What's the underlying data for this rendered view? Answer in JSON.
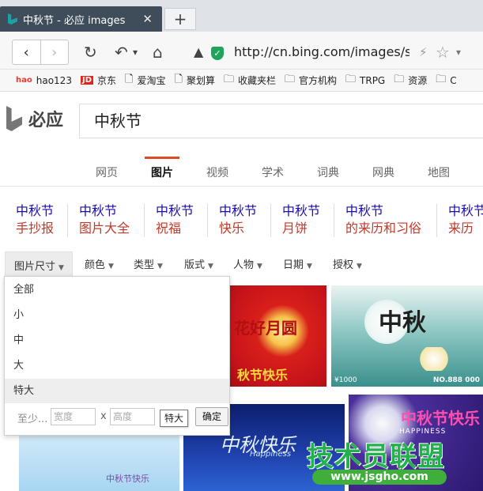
{
  "browser": {
    "tab_title": "中秋节 - 必应 images",
    "tab_close": "✕",
    "new_tab": "+",
    "url": "http://cn.bing.com/images/searc",
    "back": "‹",
    "forward": "›",
    "reload": "↻",
    "undo": "↶",
    "undo_caret": "▾",
    "home": "⌂",
    "bolt": "⚡",
    "star": "☆",
    "menu_caret": "▾",
    "bookmarks": [
      {
        "label": "hao123",
        "icon": "hao123-icon"
      },
      {
        "label": "京东",
        "icon": "jd-icon"
      },
      {
        "label": "爱淘宝",
        "icon": "page-icon"
      },
      {
        "label": "聚划算",
        "icon": "page-icon"
      },
      {
        "label": "收藏夹栏",
        "icon": "folder-icon"
      },
      {
        "label": "官方机构",
        "icon": "folder-icon"
      },
      {
        "label": "TRPG",
        "icon": "folder-icon"
      },
      {
        "label": "资源",
        "icon": "folder-icon"
      },
      {
        "label": "C",
        "icon": "folder-icon"
      }
    ]
  },
  "bing": {
    "logo_text": "必应",
    "query": "中秋节",
    "scopes": [
      "网页",
      "图片",
      "视频",
      "学术",
      "词典",
      "网典",
      "地图"
    ],
    "active_scope": "图片",
    "accent_color": "#de4a26",
    "related": [
      {
        "l1": "中秋节",
        "l2": "手抄报"
      },
      {
        "l1": "中秋节",
        "l2": "图片大全"
      },
      {
        "l1": "中秋节",
        "l2": "祝福"
      },
      {
        "l1": "中秋节",
        "l2": "快乐"
      },
      {
        "l1": "中秋节",
        "l2": "月饼"
      },
      {
        "l1": "中秋节",
        "l2": "的来历和习俗"
      },
      {
        "l1": "中秋节",
        "l2": "来历"
      }
    ],
    "filters": [
      "图片尺寸",
      "颜色",
      "类型",
      "版式",
      "人物",
      "日期",
      "授权"
    ],
    "size_dropdown": {
      "options": [
        "全部",
        "小",
        "中",
        "大",
        "特大"
      ],
      "highlighted": "特大",
      "custom_label": "至少...",
      "width_placeholder": "宽度",
      "height_placeholder": "高度",
      "times": "x",
      "ok": "确定",
      "tooltip": "特大"
    },
    "images": [
      {
        "t1": "花好月圆",
        "t2": "秋节快乐"
      },
      {
        "t1": "中秋",
        "t2": "NO.888 000",
        "t3": "¥1000"
      },
      {
        "t1": "中秋节快乐"
      },
      {
        "t1": "中秋快乐",
        "t2": "Happiness"
      },
      {
        "t1": "中秋节快乐",
        "t2": "HAPPINESS"
      }
    ]
  },
  "watermark": {
    "title": "技术员联盟",
    "url": "www.jsgho.com"
  }
}
